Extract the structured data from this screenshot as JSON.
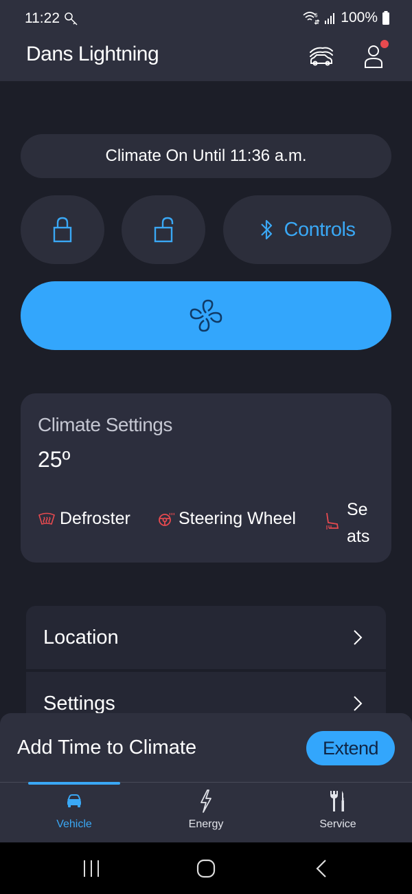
{
  "status_bar": {
    "time": "11:22",
    "battery": "100%",
    "icons": [
      "key-icon",
      "wifi-6-icon",
      "signal-icon",
      "battery-icon"
    ]
  },
  "app_bar": {
    "title": "Dans Lightning",
    "icons": [
      "garage-icon",
      "profile-icon"
    ],
    "notification_dot": true
  },
  "climate_banner": {
    "text": "Climate On Until 11:36 a.m."
  },
  "quick_actions": {
    "lock_icon": "lock-icon",
    "unlock_icon": "unlock-icon",
    "controls_label": "Controls",
    "controls_icon": "bluetooth-icon",
    "fan_icon": "fan-icon"
  },
  "climate_settings": {
    "title": "Climate Settings",
    "temperature": "25º",
    "features": [
      {
        "label": "Defroster",
        "icon": "defroster-icon"
      },
      {
        "label": "Steering Wheel",
        "icon": "heated-steering-wheel-icon"
      },
      {
        "label": "Seats",
        "icon": "heated-seat-icon"
      }
    ]
  },
  "menu": {
    "items": [
      {
        "label": "Location"
      },
      {
        "label": "Settings"
      }
    ]
  },
  "bottom_sheet": {
    "title": "Add Time to Climate",
    "action_label": "Extend"
  },
  "tabs": [
    {
      "label": "Vehicle",
      "icon": "car-icon",
      "active": true
    },
    {
      "label": "Energy",
      "icon": "lightning-icon",
      "active": false
    },
    {
      "label": "Service",
      "icon": "tools-icon",
      "active": false
    }
  ],
  "colors": {
    "accent": "#33a6fc",
    "background": "#1c1e28",
    "card": "#2c2e3b",
    "heat_indicator": "#e84a4f",
    "notification": "#e84a4f"
  }
}
